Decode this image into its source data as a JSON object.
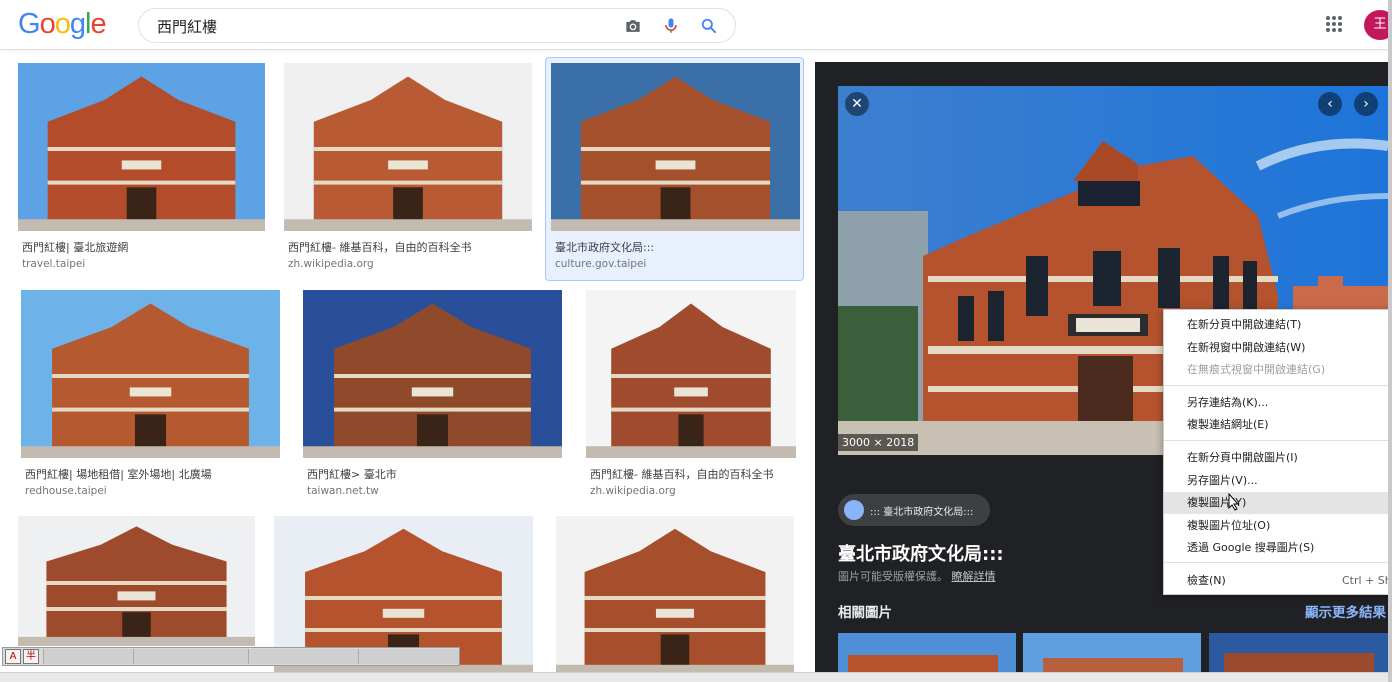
{
  "header": {
    "logo_letters": [
      {
        "ch": "G",
        "color": "#4285f4"
      },
      {
        "ch": "o",
        "color": "#ea4335"
      },
      {
        "ch": "o",
        "color": "#fbbc05"
      },
      {
        "ch": "g",
        "color": "#4285f4"
      },
      {
        "ch": "l",
        "color": "#34a853"
      },
      {
        "ch": "e",
        "color": "#ea4335"
      }
    ],
    "search_value": "西門紅樓",
    "avatar_letter": "王"
  },
  "results": [
    {
      "title": "西門紅樓| 臺北旅遊網",
      "source": "travel.taipei",
      "selected": false
    },
    {
      "title": "西門紅樓- 維基百科，自由的百科全书",
      "source": "zh.wikipedia.org",
      "selected": false
    },
    {
      "title": "臺北市政府文化局:::",
      "source": "culture.gov.taipei",
      "selected": true
    },
    {
      "title": "西門紅樓| 場地租借| 室外場地| 北廣場",
      "source": "redhouse.taipei",
      "selected": false
    },
    {
      "title": "西門紅樓> 臺北市",
      "source": "taiwan.net.tw",
      "selected": false
    },
    {
      "title": "西門紅樓- 維基百科，自由的百科全书",
      "source": "zh.wikipedia.org",
      "selected": false
    },
    {
      "title": "",
      "source": "",
      "selected": false
    },
    {
      "title": "",
      "source": "",
      "selected": false
    },
    {
      "title": "",
      "source": "",
      "selected": false
    }
  ],
  "panel": {
    "dimensions": "3000 × 2018",
    "source_chip": "::: 臺北市政府文化局:::",
    "title": "臺北市政府文化局:::",
    "copyright_text": "圖片可能受版權保護。",
    "learn_more": "瞭解詳情",
    "related_label": "相關圖片",
    "more_label": "顯示更多結果"
  },
  "context_menu": [
    {
      "label": "在新分頁中開啟連結(T)",
      "disabled": false,
      "shortcut": ""
    },
    {
      "label": "在新視窗中開啟連結(W)",
      "disabled": false,
      "shortcut": ""
    },
    {
      "label": "在無痕式視窗中開啟連結(G)",
      "disabled": true,
      "shortcut": ""
    },
    {
      "label": "另存連結為(K)...",
      "disabled": false,
      "shortcut": ""
    },
    {
      "label": "複製連結網址(E)",
      "disabled": false,
      "shortcut": ""
    },
    {
      "label": "在新分頁中開啟圖片(I)",
      "disabled": false,
      "shortcut": ""
    },
    {
      "label": "另存圖片(V)...",
      "disabled": false,
      "shortcut": ""
    },
    {
      "label": "複製圖片(Y)",
      "disabled": false,
      "shortcut": "",
      "highlighted": true
    },
    {
      "label": "複製圖片位址(O)",
      "disabled": false,
      "shortcut": ""
    },
    {
      "label": "透過 Google 搜尋圖片(S)",
      "disabled": false,
      "shortcut": ""
    },
    {
      "label": "檢查(N)",
      "disabled": false,
      "shortcut": "Ctrl + Sh"
    }
  ],
  "ime": {
    "key1": "A",
    "key2": "半"
  },
  "icons": {
    "camera": "camera-icon",
    "mic": "microphone-icon",
    "search": "search-icon",
    "apps": "apps-grid-icon",
    "close": "close-icon",
    "prev": "chevron-left-icon",
    "next": "chevron-right-icon",
    "globe": "globe-icon"
  }
}
